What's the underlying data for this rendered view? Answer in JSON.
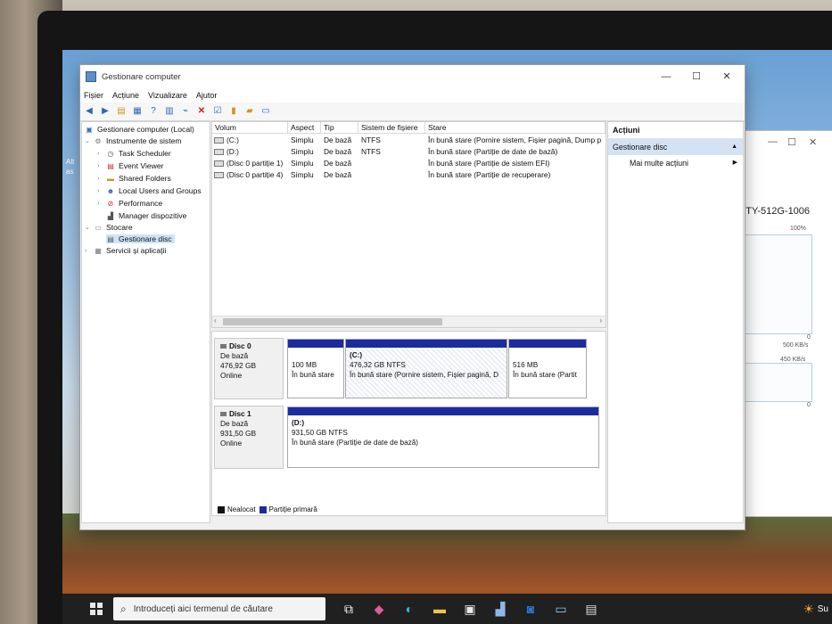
{
  "window": {
    "title": "Gestionare computer",
    "minimize": "—",
    "maximize": "☐",
    "close": "✕"
  },
  "menu": [
    "Fișier",
    "Acțiune",
    "Vizualizare",
    "Ajutor"
  ],
  "tree": {
    "root": "Gestionare computer (Local)",
    "system_tools": "Instrumente de sistem",
    "task_scheduler": "Task Scheduler",
    "event_viewer": "Event Viewer",
    "shared_folders": "Shared Folders",
    "local_users": "Local Users and Groups",
    "performance": "Performance",
    "device_manager": "Manager dispozitive",
    "storage": "Stocare",
    "disk_management": "Gestionare disc",
    "services": "Servicii și aplicații"
  },
  "volume_list": {
    "headers": [
      "Volum",
      "Aspect",
      "Tip",
      "Sistem de fișiere",
      "Stare"
    ],
    "rows": [
      {
        "volume": "(C:)",
        "layout": "Simplu",
        "type": "De bază",
        "fs": "NTFS",
        "status": "În bună stare (Pornire sistem, Fișier pagină, Dump p"
      },
      {
        "volume": "(D:)",
        "layout": "Simplu",
        "type": "De bază",
        "fs": "NTFS",
        "status": "În bună stare (Partiție de date de bază)"
      },
      {
        "volume": "(Disc 0 partiție 1)",
        "layout": "Simplu",
        "type": "De bază",
        "fs": "",
        "status": "În bună stare (Partiție de sistem EFI)"
      },
      {
        "volume": "(Disc 0 partiție 4)",
        "layout": "Simplu",
        "type": "De bază",
        "fs": "",
        "status": "În bună stare (Partiție de recuperare)"
      }
    ]
  },
  "disks": {
    "disk0": {
      "name": "Disc 0",
      "type": "De bază",
      "size": "476,92 GB",
      "status": "Online",
      "p1": {
        "size": "100 MB",
        "status": "În bună stare"
      },
      "p2": {
        "name": "(C:)",
        "size": "476,32 GB NTFS",
        "status": "În bună stare (Pornire sistem, Fișier pagină, D"
      },
      "p3": {
        "size": "516 MB",
        "status": "În bună stare (Partit"
      }
    },
    "disk1": {
      "name": "Disc 1",
      "type": "De bază",
      "size": "931,50 GB",
      "status": "Online",
      "p1": {
        "name": "(D:)",
        "size": "931,50 GB NTFS",
        "status": "În bună stare (Partiție de date de bază)"
      }
    }
  },
  "legend": {
    "unallocated": "Nealocat",
    "primary": "Partiție primară"
  },
  "actions": {
    "header": "Acțiuni",
    "section": "Gestionare disc",
    "more": "Mai multe acțiuni"
  },
  "background_window": {
    "title": "PNTY-512G-1006",
    "pct": "100%",
    "rate1": "500 KB/s",
    "rate2": "450 KB/s",
    "zero1": "0",
    "zero2": "0"
  },
  "desktop_icon_text": [
    "Alt",
    "as"
  ],
  "taskbar": {
    "search_placeholder": "Introduceți aici termenul de căutare",
    "right_text": "Su"
  },
  "colors": {
    "partition_bar": "#1b2ca0",
    "unallocated": "#111111",
    "selection": "#cce4f7",
    "actions_section": "#d4e3f4"
  }
}
